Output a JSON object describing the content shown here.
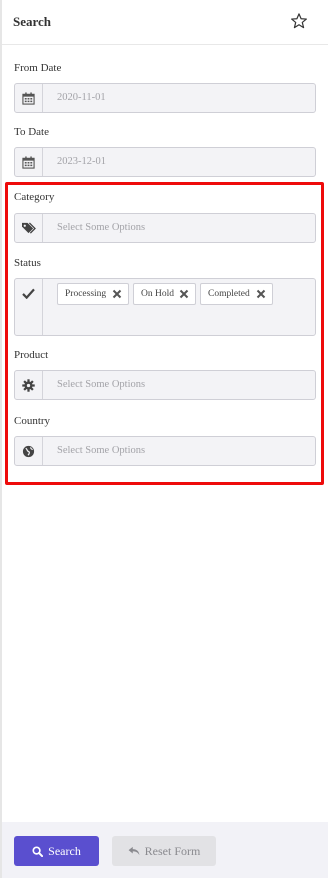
{
  "header": {
    "title": "Search",
    "favorite_icon": "star-icon"
  },
  "form": {
    "from_date": {
      "label": "From Date",
      "value": "2020-11-01",
      "icon": "calendar-icon"
    },
    "to_date": {
      "label": "To Date",
      "value": "2023-12-01",
      "icon": "calendar-icon"
    },
    "category": {
      "label": "Category",
      "placeholder": "Select Some Options",
      "icon": "tags-icon"
    },
    "status": {
      "label": "Status",
      "icon": "check-icon",
      "selected": [
        "Processing",
        "On Hold",
        "Completed"
      ]
    },
    "product": {
      "label": "Product",
      "placeholder": "Select Some Options",
      "icon": "gear-icon"
    },
    "country": {
      "label": "Country",
      "placeholder": "Select Some Options",
      "icon": "globe-icon"
    }
  },
  "footer": {
    "search_label": "Search",
    "reset_label": "Reset Form"
  },
  "colors": {
    "highlight": "#ee0b0b",
    "primary_button": "#5a4fcf",
    "field_bg": "#f3f3f6"
  }
}
